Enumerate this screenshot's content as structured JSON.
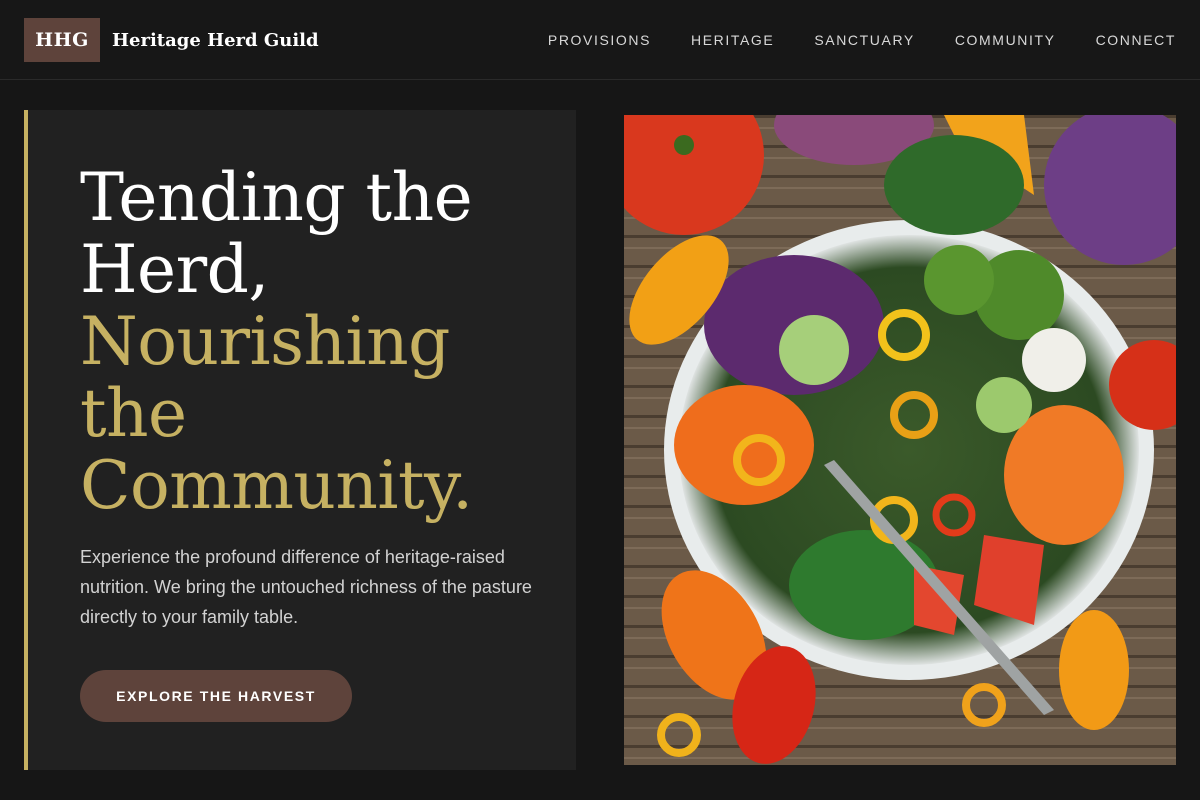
{
  "brand": {
    "logo": "HHG",
    "name": "Heritage Herd Guild"
  },
  "nav": [
    "PROVISIONS",
    "HERITAGE",
    "SANCTUARY",
    "COMMUNITY",
    "CONNECT"
  ],
  "hero": {
    "title_lines": [
      "Tending the",
      "Herd,",
      "Nourishing",
      "the",
      "Community."
    ],
    "description": "Experience the profound difference of heritage-raised nutrition. We bring the untouched richness of the pasture directly to your family table.",
    "cta": "EXPLORE THE HARVEST"
  },
  "colors": {
    "accent_gold": "#c6b162",
    "brand_brown": "#5e433b",
    "background": "#161616",
    "panel": "#212121"
  }
}
